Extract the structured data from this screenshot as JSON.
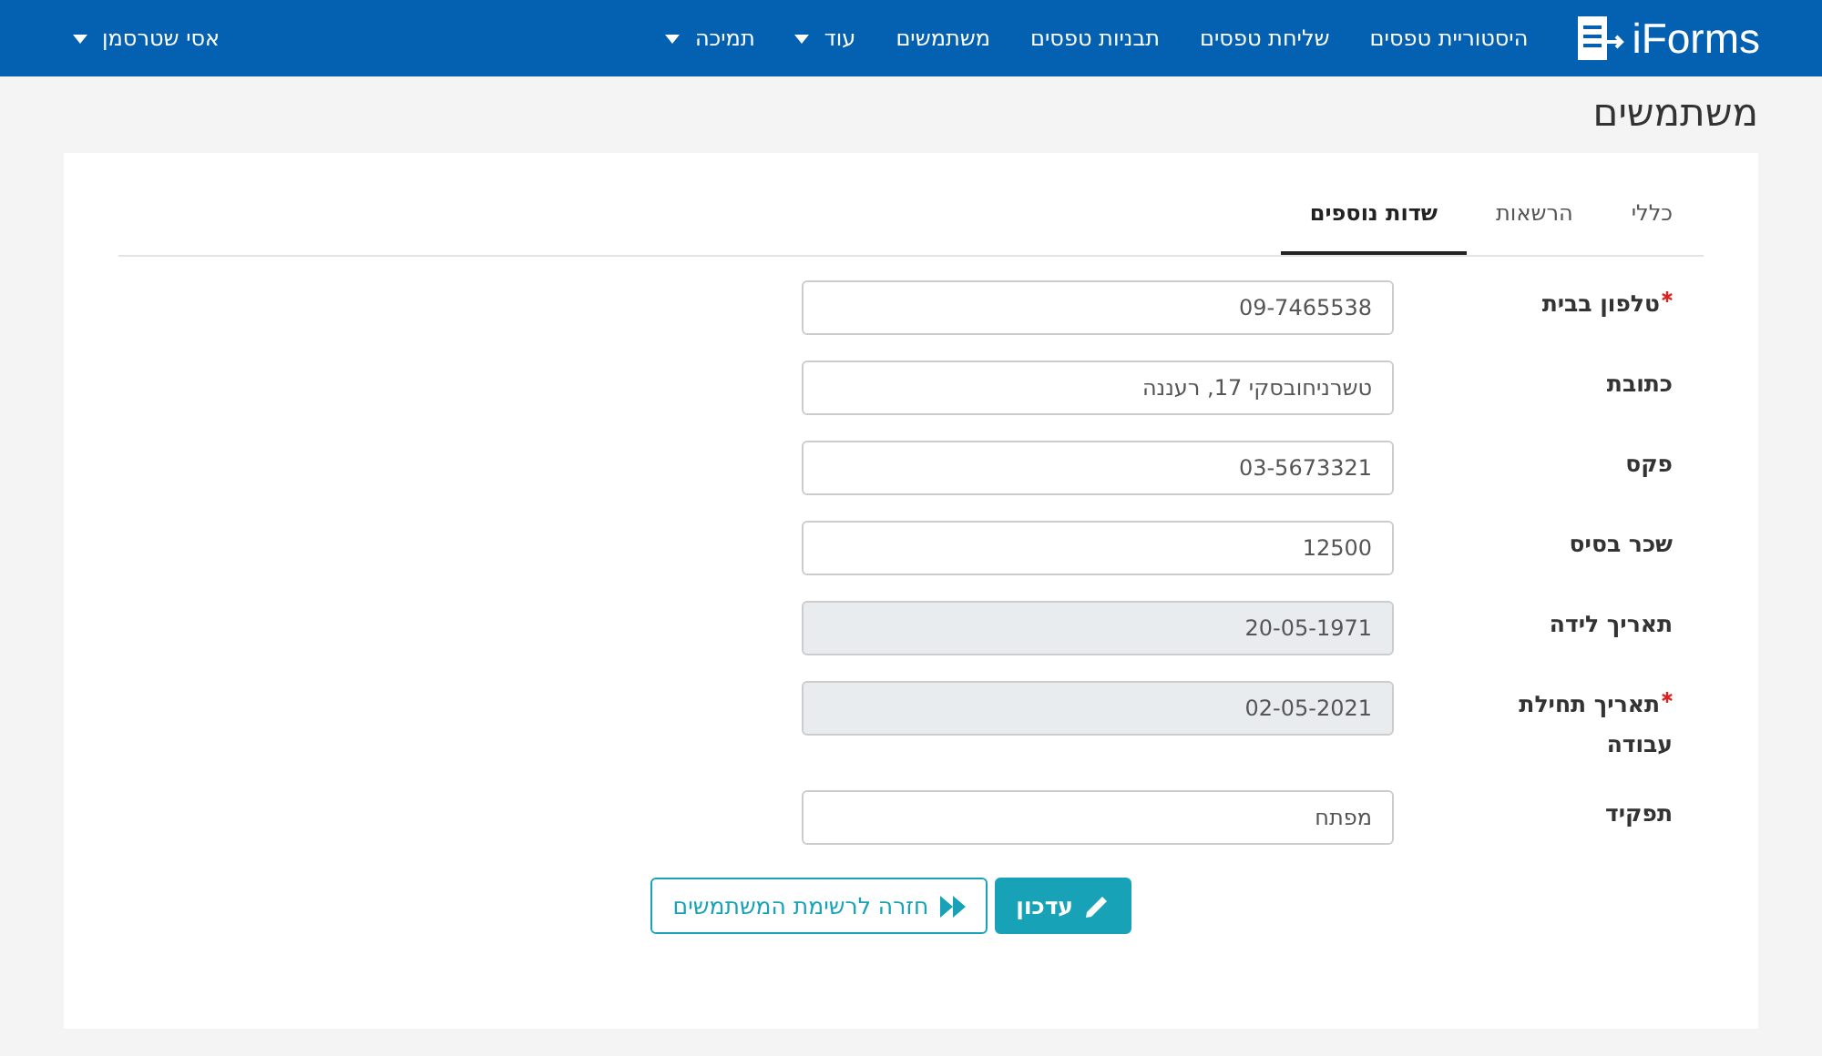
{
  "navbar": {
    "logo": "iForms",
    "items": [
      {
        "label": "היסטוריית טפסים",
        "dropdown": false
      },
      {
        "label": "שליחת טפסים",
        "dropdown": false
      },
      {
        "label": "תבניות טפסים",
        "dropdown": false
      },
      {
        "label": "משתמשים",
        "dropdown": false
      },
      {
        "label": "עוד",
        "dropdown": true
      },
      {
        "label": "תמיכה",
        "dropdown": true
      }
    ],
    "user": "אסי שטרסמן"
  },
  "page_title": "משתמשים",
  "tabs": [
    {
      "label": "כללי",
      "selected": false
    },
    {
      "label": "הרשאות",
      "selected": false
    },
    {
      "label": "שדות נוספים",
      "selected": true
    }
  ],
  "fields": [
    {
      "label": "טלפון בבית",
      "value": "09-7465538",
      "required": true,
      "disabled": false
    },
    {
      "label": "כתובת",
      "value": "טשרניחובסקי 17, רעננה",
      "required": false,
      "disabled": false
    },
    {
      "label": "פקס",
      "value": "03-5673321",
      "required": false,
      "disabled": false
    },
    {
      "label": "שכר בסיס",
      "value": "12500",
      "required": false,
      "disabled": false
    },
    {
      "label": "תאריך לידה",
      "value": "20-05-1971",
      "required": false,
      "disabled": true
    },
    {
      "label": "תאריך תחילת עבודה",
      "value": "02-05-2021",
      "required": true,
      "disabled": true
    },
    {
      "label": "תפקיד",
      "value": "מפתח",
      "required": false,
      "disabled": false
    }
  ],
  "buttons": {
    "update": "עדכון",
    "back": "חזרה לרשימת המשתמשים"
  }
}
